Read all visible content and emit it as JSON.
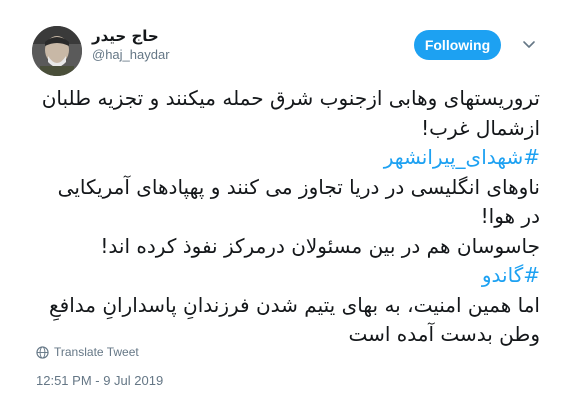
{
  "author": {
    "display_name": "حاج حیدر",
    "handle": "@haj_haydar"
  },
  "follow_button": {
    "label": "Following"
  },
  "tweet": {
    "lines": [
      "تروریستهای وهابی ازجنوب شرق حمله میکنند و تجزیه طلبان",
      "ازشمال غرب!",
      "#شهدای_پیرانشهر",
      "ناوهای انگلیسی در دریا تجاوز می کنند و پهپادهای آمریکایی",
      "در هوا!",
      "جاسوسان هم در بین مسئولان درمرکز نفوذ کرده اند!",
      "#گاندو",
      "اما همین امنیت، به بهای یتیم شدن فرزندانِ پاسدارانِ مدافعِ",
      "وطن بدست آمده است"
    ]
  },
  "translate_link": {
    "label": "Translate Tweet",
    "icon": "globe-icon"
  },
  "timestamp": "12:51 PM - 9 Jul 2019",
  "colors": {
    "accent": "#1da1f2",
    "text": "#14171a",
    "muted": "#657786"
  }
}
